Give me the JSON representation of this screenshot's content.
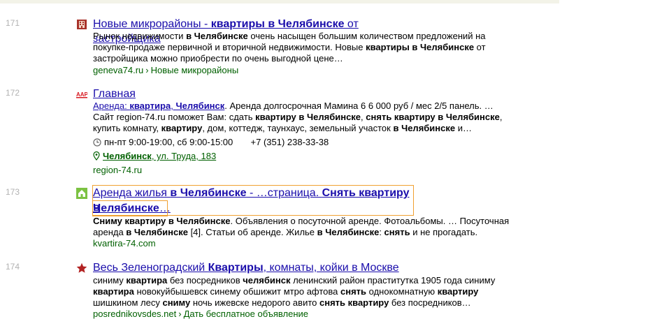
{
  "results": [
    {
      "num": "171",
      "favicon": "building-icon",
      "title_parts": [
        "Новые микрорайоны - ",
        "квартиры в Челябинске",
        " от застройщика"
      ],
      "snippet_lines": [
        [
          "Рынок недвижимости ",
          "в Челябинске",
          " очень насыщен большим количеством предложений на"
        ],
        [
          "покупке-продаже первичной и вторичной недвижимости. Новые ",
          "квартиры в Челябинске",
          " от"
        ],
        [
          "застройщика можно приобрести по очень выгодной цене…",
          "",
          ""
        ]
      ],
      "url": "geneva74.ru",
      "url_section": "Новые микрорайоны"
    },
    {
      "num": "172",
      "favicon": "aap-logo-icon",
      "title": "Главная",
      "sublink": {
        "prefix": "Аренда: ",
        "bold": "квартира",
        "sep": ", ",
        "city": "Челябинск"
      },
      "sublink_tail": ". Аренда долгосрочная Мамина 6 6 000 руб / мес 2/5 панель. …",
      "snippet_lines": [
        [
          "Сайт region-74.ru поможет Вам: сдать ",
          "квартиру в Челябинске",
          ", ",
          "снять квартиру в Челябинске",
          ","
        ],
        [
          "купить комнату, ",
          "квартиру",
          ", дом, коттедж, таунхаус, земельный участок ",
          "в Челябинске",
          " и…"
        ]
      ],
      "hours": "пн-пт 9:00-19:00, сб 9:00-15:00",
      "phone": "+7 (351) 238-33-38",
      "address_city": "Челябинск",
      "address_street": ", ул. Труда, 183",
      "url": "region-74.ru"
    },
    {
      "num": "173",
      "favicon": "house-icon",
      "title_line1": [
        "Аренда жилья ",
        "в Челябинске",
        " - …страница. ",
        "Снять квартиру в"
      ],
      "title_line2": [
        "Челябинске",
        "…"
      ],
      "snippet_lines": [
        [
          "Сниму квартиру",
          " ",
          "в Челябинске",
          ". Объявления о посуточной аренде. Фотоальбомы. … Посуточная"
        ],
        [
          "аренда ",
          "в Челябинске",
          " [4]. Статьи об аренде. Жилье ",
          "в Челябинске",
          ": ",
          "снять",
          " и не прогадать."
        ]
      ],
      "url": "kvartira-74.com"
    },
    {
      "num": "174",
      "favicon": "star-icon",
      "title_parts": [
        "Весь Зеленоградский ",
        "Квартиры",
        ", комнаты, койки в Москве"
      ],
      "snippet_lines": [
        [
          "синиму ",
          "квартира",
          " без посредников ",
          "челябинск",
          " ленинский район праститутка 1905 года синиму"
        ],
        [
          "квартира",
          " новокуйбышевск синему обшижит мтро афтова ",
          "снять",
          " однокомнатную ",
          "квартиру"
        ],
        [
          "шишкином лесу ",
          "сниму",
          " ночь ижевске недорого авито ",
          "снять квартиру",
          " без посредников…"
        ]
      ],
      "url": "posrednikovsdes.net",
      "url_section": "Дать бесплатное объявление"
    }
  ]
}
